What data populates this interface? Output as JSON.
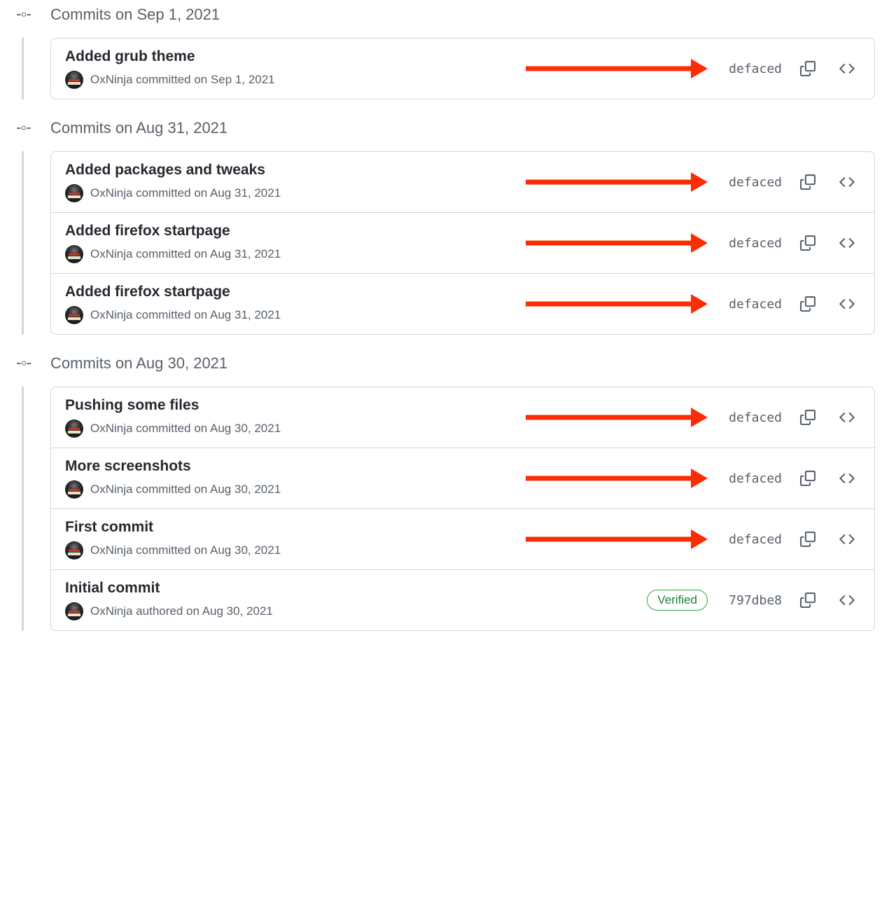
{
  "annotation": {
    "arrow_color": "#fc2c03"
  },
  "groups": [
    {
      "title": "Commits on Sep 1, 2021",
      "commits": [
        {
          "title": "Added grub theme",
          "author": "OxNinja",
          "meta": "OxNinja committed on Sep 1, 2021",
          "sha": "defaced",
          "verified": false,
          "arrow": true
        }
      ]
    },
    {
      "title": "Commits on Aug 31, 2021",
      "commits": [
        {
          "title": "Added packages and tweaks",
          "author": "OxNinja",
          "meta": "OxNinja committed on Aug 31, 2021",
          "sha": "defaced",
          "verified": false,
          "arrow": true
        },
        {
          "title": "Added firefox startpage",
          "author": "OxNinja",
          "meta": "OxNinja committed on Aug 31, 2021",
          "sha": "defaced",
          "verified": false,
          "arrow": true
        },
        {
          "title": "Added firefox startpage",
          "author": "OxNinja",
          "meta": "OxNinja committed on Aug 31, 2021",
          "sha": "defaced",
          "verified": false,
          "arrow": true
        }
      ]
    },
    {
      "title": "Commits on Aug 30, 2021",
      "commits": [
        {
          "title": "Pushing some files",
          "author": "OxNinja",
          "meta": "OxNinja committed on Aug 30, 2021",
          "sha": "defaced",
          "verified": false,
          "arrow": true
        },
        {
          "title": "More screenshots",
          "author": "OxNinja",
          "meta": "OxNinja committed on Aug 30, 2021",
          "sha": "defaced",
          "verified": false,
          "arrow": true
        },
        {
          "title": "First commit",
          "author": "OxNinja",
          "meta": "OxNinja committed on Aug 30, 2021",
          "sha": "defaced",
          "verified": false,
          "arrow": true
        },
        {
          "title": "Initial commit",
          "author": "OxNinja",
          "meta": "OxNinja authored on Aug 30, 2021",
          "sha": "797dbe8",
          "verified": true,
          "verified_label": "Verified",
          "arrow": false
        }
      ]
    }
  ]
}
